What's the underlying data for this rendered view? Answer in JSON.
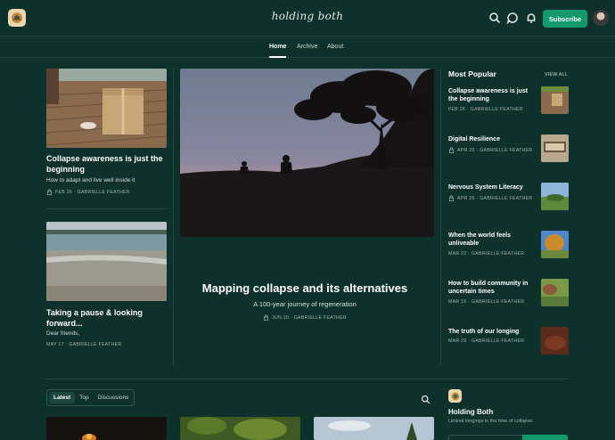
{
  "header": {
    "brand": "holding both",
    "subscribe_label": "Subscribe"
  },
  "nav": {
    "items": [
      "Home",
      "Archive",
      "About"
    ],
    "active": "Home"
  },
  "left_cards": [
    {
      "title": "Collapse awareness is just the beginning",
      "subtitle": "How to adapt and live well inside it",
      "meta": "FEB 26 · GABRIELLE FEATHER",
      "locked": true
    },
    {
      "title": "Taking a pause & looking forward...",
      "subtitle": "Dear friends,",
      "meta": "MAY 17 · GABRIELLE FEATHER",
      "locked": false
    }
  ],
  "featured": {
    "title": "Mapping collapse and its alternatives",
    "subtitle": "A 100-year journey of regeneration",
    "meta": "JUN 20 · GABRIELLE FEATHER",
    "locked": true
  },
  "most_popular": {
    "heading": "Most Popular",
    "view_all": "VIEW ALL",
    "items": [
      {
        "title": "Collapse awareness is just the beginning",
        "meta": "FEB 26 · GABRIELLE FEATHER",
        "locked": false
      },
      {
        "title": "Digital Resilience",
        "meta": "APR 20 · GABRIELLE FEATHER",
        "locked": true
      },
      {
        "title": "Nervous System Literacy",
        "meta": "APR 26 · GABRIELLE FEATHER",
        "locked": true
      },
      {
        "title": "When the world feels unliveable",
        "meta": "MAR 22 · GABRIELLE FEATHER",
        "locked": false
      },
      {
        "title": "How to build community in uncertain times",
        "meta": "MAR 16 · GABRIELLE FEATHER",
        "locked": false
      },
      {
        "title": "The truth of our longing",
        "meta": "MAR 29 · GABRIELLE FEATHER",
        "locked": false
      }
    ]
  },
  "feed": {
    "tabs": [
      "Latest",
      "Top",
      "Discussions"
    ],
    "active_tab": "Latest"
  },
  "sidebar": {
    "name": "Holding Both",
    "description": "Liminal longings in the time of collapse."
  },
  "colors": {
    "background": "#0f312b",
    "accent": "#13996c"
  },
  "icons": [
    "logo-icon",
    "search-icon",
    "chat-icon",
    "bell-icon",
    "lock-icon"
  ]
}
